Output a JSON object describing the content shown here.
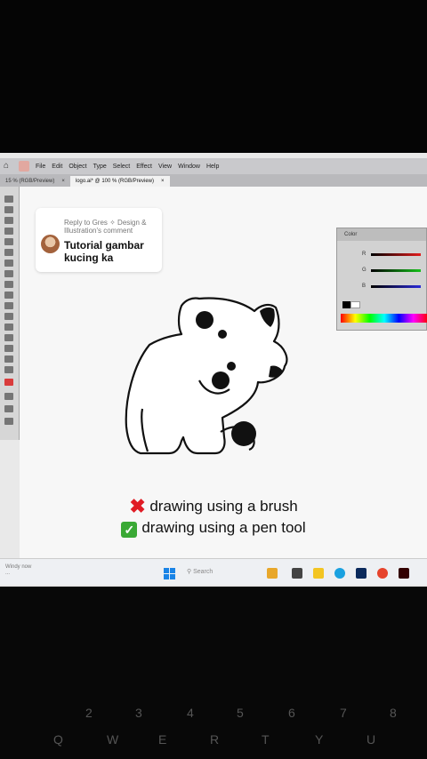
{
  "app": {
    "menu": [
      "File",
      "Edit",
      "Object",
      "Type",
      "Select",
      "Effect",
      "View",
      "Window",
      "Help"
    ],
    "tabs": [
      {
        "label": "15 % (RGB/Preview)",
        "active": false
      },
      {
        "label": "logo.ai* @ 100 % (RGB/Preview)",
        "active": true
      }
    ]
  },
  "comment": {
    "reply_line": "Reply to Gres ✧ Design & Illustration's comment",
    "text": "Tutorial gambar kucing ka"
  },
  "color_panel": {
    "title": "Color",
    "channels": [
      "R",
      "G",
      "B"
    ],
    "accent_colors": {
      "red": "#e31d1d",
      "green": "#16c11b",
      "blue": "#2b2bd8"
    }
  },
  "caption": {
    "line1": "drawing using a brush",
    "line2": "drawing using a pen tool"
  },
  "taskbar": {
    "search_placeholder": "Search",
    "note_line1": "Windy now",
    "note_line2": "..."
  },
  "keyboard": {
    "row1": [
      "2",
      "3",
      "4",
      "5",
      "6",
      "7",
      "8"
    ],
    "row2": [
      "Q",
      "W",
      "E",
      "R",
      "T",
      "Y",
      "U"
    ]
  }
}
